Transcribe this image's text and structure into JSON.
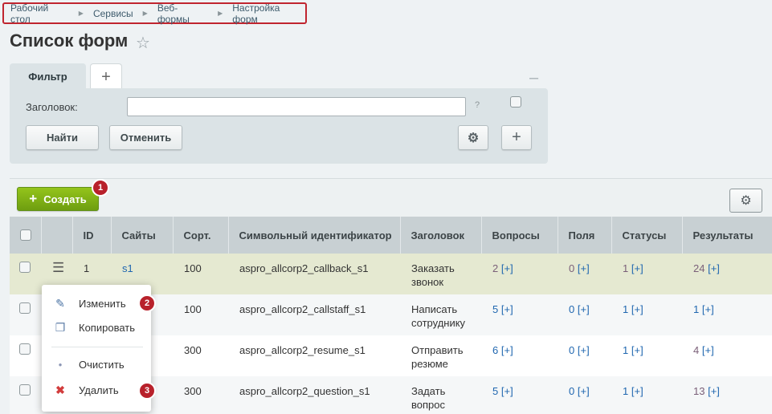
{
  "breadcrumb": [
    "Рабочий стол",
    "Сервисы",
    "Веб-формы",
    "Настройка форм"
  ],
  "title": "Список форм",
  "tabs": {
    "filter": "Фильтр",
    "add": "+"
  },
  "filter": {
    "label": "Заголовок:",
    "value": "",
    "help": "?",
    "find": "Найти",
    "cancel": "Отменить"
  },
  "toolbar": {
    "create": "Создать",
    "badge1": "1"
  },
  "columns": [
    "ID",
    "Сайты",
    "Сорт.",
    "Символьный идентификатор",
    "Заголовок",
    "Вопросы",
    "Поля",
    "Статусы",
    "Результаты"
  ],
  "rows": [
    {
      "id": "1",
      "site": "s1",
      "sort": "100",
      "code": "aspro_allcorp2_callback_s1",
      "title": "Заказать звонок",
      "questions": "2",
      "fields": "0",
      "statuses": "1",
      "results": "24"
    },
    {
      "id": "",
      "site": "",
      "sort": "100",
      "code": "aspro_allcorp2_callstaff_s1",
      "title": "Написать сотруднику",
      "questions": "5",
      "fields": "0",
      "statuses": "1",
      "results": "1"
    },
    {
      "id": "",
      "site": "",
      "sort": "300",
      "code": "aspro_allcorp2_resume_s1",
      "title": "Отправить резюме",
      "questions": "6",
      "fields": "0",
      "statuses": "1",
      "results": "4"
    },
    {
      "id": "",
      "site": "",
      "sort": "300",
      "code": "aspro_allcorp2_question_s1",
      "title": "Задать вопрос",
      "questions": "5",
      "fields": "0",
      "statuses": "1",
      "results": "13"
    }
  ],
  "add_label": "[+]",
  "popup": {
    "edit": "Изменить",
    "copy": "Копировать",
    "clear": "Очистить",
    "delete": "Удалить",
    "badge2": "2",
    "badge3": "3"
  },
  "colors": {
    "accent_red": "#b8212b",
    "create_green": "#7fb015",
    "link_blue": "#2067b0",
    "highlight_row": "#e5e9d1"
  }
}
